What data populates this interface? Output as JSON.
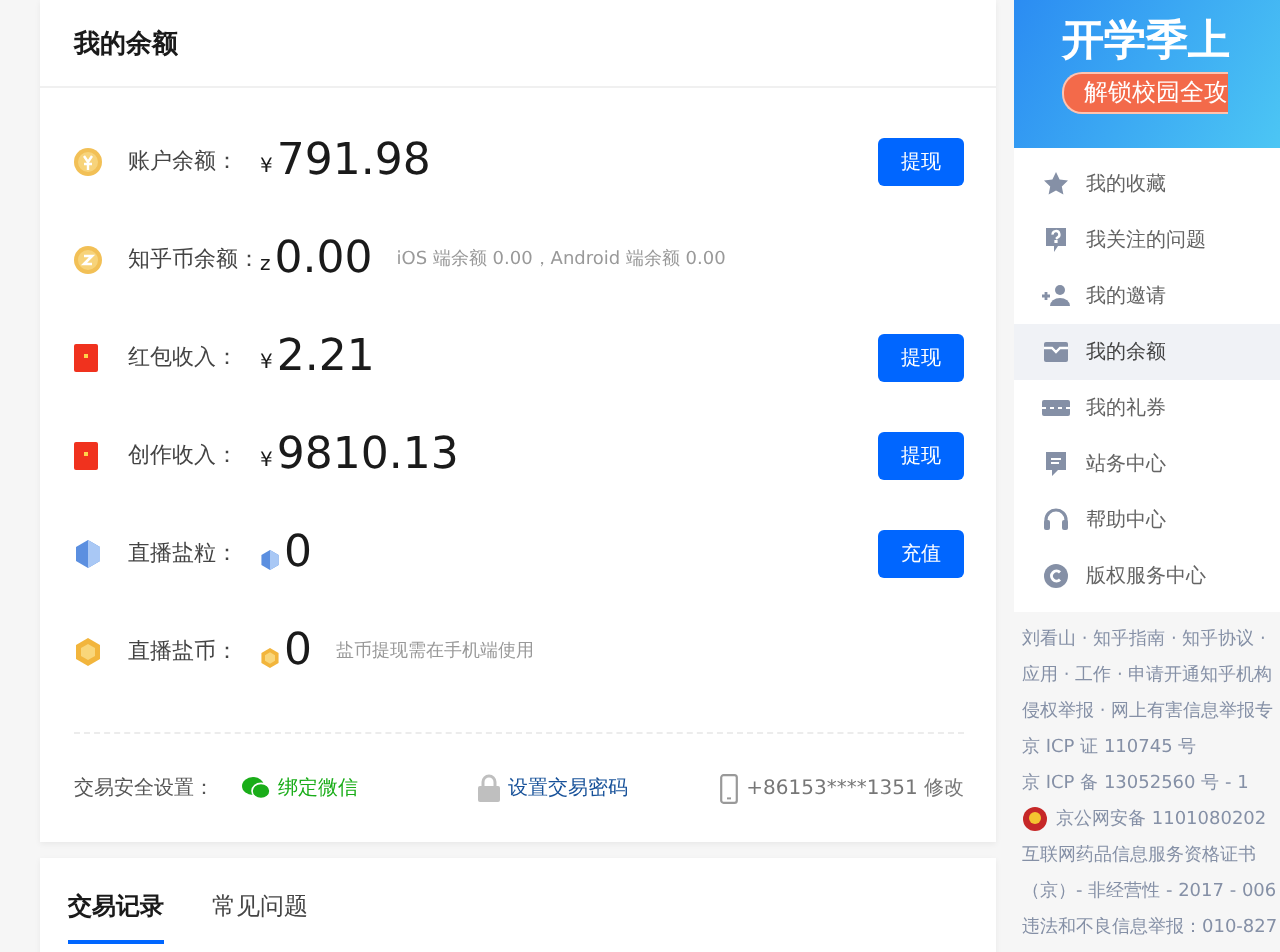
{
  "balance_card": {
    "title": "我的余额",
    "rows": [
      {
        "label": "账户余额：",
        "currency": "¥",
        "amount": "791.98",
        "button": "提现"
      },
      {
        "label": "知乎币余额：",
        "currency": "z",
        "amount": "0.00",
        "note": "iOS 端余额 0.00，Android 端余额 0.00"
      },
      {
        "label": "红包收入：",
        "currency": "¥",
        "amount": "2.21",
        "button": "提现"
      },
      {
        "label": "创作收入：",
        "currency": "¥",
        "amount": "9810.13",
        "button": "提现"
      },
      {
        "label": "直播盐粒：",
        "amount": "0",
        "button": "充值"
      },
      {
        "label": "直播盐币：",
        "amount": "0",
        "note": "盐币提现需在手机端使用"
      }
    ],
    "security": {
      "label": "交易安全设置：",
      "items": [
        {
          "kind": "wechat",
          "text": "绑定微信"
        },
        {
          "kind": "lock",
          "text": "设置交易密码"
        },
        {
          "kind": "phone",
          "text": "+86153****1351 修改"
        }
      ]
    }
  },
  "tabs": [
    {
      "label": "交易记录",
      "selected": true
    },
    {
      "label": "常见问题",
      "selected": false
    }
  ],
  "sidebar": {
    "banner": {
      "headline": "开学季上",
      "tagline": "解锁校园全攻"
    },
    "items": [
      {
        "label": "我的收藏",
        "selected": false
      },
      {
        "label": "我关注的问题",
        "selected": false
      },
      {
        "label": "我的邀请",
        "selected": false
      },
      {
        "label": "我的余额",
        "selected": true
      },
      {
        "label": "我的礼券",
        "selected": false
      },
      {
        "label": "站务中心",
        "selected": false
      },
      {
        "label": "帮助中心",
        "selected": false
      },
      {
        "label": "版权服务中心",
        "selected": false
      }
    ],
    "footer": [
      {
        "kind": "text",
        "text": "刘看山 · 知乎指南 · 知乎协议 ·"
      },
      {
        "kind": "text",
        "text": "应用 · 工作 · 申请开通知乎机构"
      },
      {
        "kind": "text",
        "text": "侵权举报 · 网上有害信息举报专"
      },
      {
        "kind": "text",
        "text": "京 ICP 证 110745 号"
      },
      {
        "kind": "text",
        "text": "京 ICP 备 13052560 号 - 1"
      },
      {
        "kind": "police",
        "text": "京公网安备 1101080202"
      },
      {
        "kind": "text",
        "text": "互联网药品信息服务资格证书"
      },
      {
        "kind": "text",
        "text": "（京）- 非经营性 - 2017 - 006"
      },
      {
        "kind": "text",
        "text": "违法和不良信息举报：010-827"
      }
    ]
  }
}
